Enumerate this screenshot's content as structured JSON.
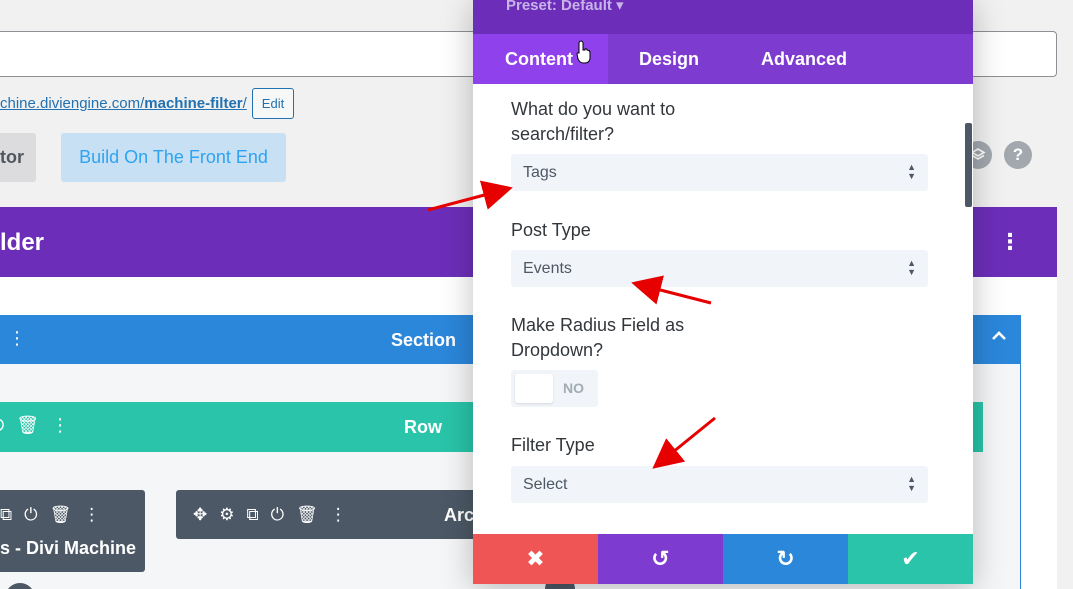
{
  "page": {
    "permalink_prefix": "chine.diviengine.com/",
    "permalink_slug": "machine-filter",
    "permalink_suffix": "/",
    "edit_label": "Edit",
    "editor_button_label": "tor",
    "front_end_button_label": "Build On The Front End",
    "layers_icon": "layers-icon",
    "help_label": "?"
  },
  "builder": {
    "title": "lder",
    "menu_icon": "⋮",
    "section_label": "Section",
    "row_label": "Row",
    "modules": [
      {
        "name": "s - Divi Machine"
      },
      {
        "name": "Arc"
      }
    ]
  },
  "modal": {
    "preset_label": "Preset: Default ▾",
    "tabs": [
      {
        "label": "Content",
        "active": true
      },
      {
        "label": "Design",
        "active": false
      },
      {
        "label": "Advanced",
        "active": false
      }
    ],
    "fields": {
      "search_filter": {
        "label": "What do you want to search/filter?",
        "value": "Tags"
      },
      "post_type": {
        "label": "Post Type",
        "value": "Events"
      },
      "radius_dropdown": {
        "label": "Make Radius Field as Dropdown?",
        "state": "NO"
      },
      "filter_type": {
        "label": "Filter Type",
        "value": "Select"
      }
    },
    "footer": {
      "close_icon": "✖",
      "undo_icon": "↺",
      "redo_icon": "↻",
      "save_icon": "✔"
    }
  },
  "colors": {
    "purple": "#6c2eb9",
    "tab_purple": "#7e3bd0",
    "section_blue": "#2b87da",
    "row_green": "#29c4a9",
    "module_gray": "#4c5866",
    "close_red": "#ef5555",
    "annotation_red": "#e60000"
  }
}
